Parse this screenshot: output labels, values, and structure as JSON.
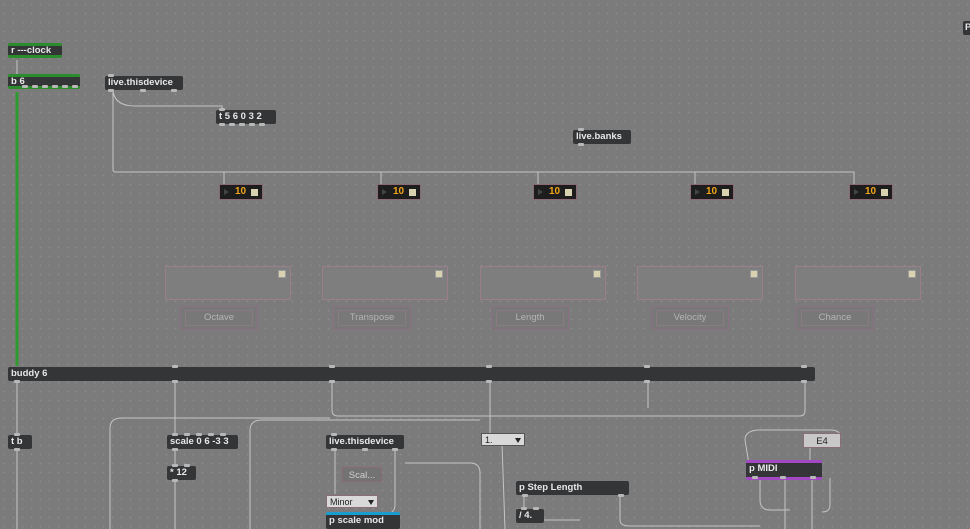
{
  "objects": {
    "r_clock": "r ---clock",
    "b6": "b 6",
    "live_thisdevice_1": "live.thisdevice",
    "t_56032": "t 5 6 0 3 2",
    "live_banks": "live.banks",
    "buddy": "buddy 6",
    "tb": "t b",
    "scale": "scale 0 6 -3 3",
    "mul12": "* 12",
    "live_thisdevice_2": "live.thisdevice",
    "scal_msg": "Scal...",
    "minor_menu": "Minor",
    "p_scale_mod": "p scale mod",
    "one_menu": "1.",
    "p_step_length": "p Step Length",
    "div4": "/ 4.",
    "e4_msg": "E4",
    "p_midi": "p MIDI",
    "edge_letter": "P"
  },
  "numboxes": [
    "10",
    "10",
    "10",
    "10",
    "10"
  ],
  "params": [
    "Octave",
    "Transpose",
    "Length",
    "Velocity",
    "Chance"
  ],
  "colors": {
    "background": "#7b7b7b",
    "object": "#333537",
    "send_receive": "#2a8c2a",
    "number_text": "#f2a51a",
    "cord": "#c4c4c4",
    "midi_accent": "#a347c4",
    "scale_accent": "#1b9ccf"
  }
}
